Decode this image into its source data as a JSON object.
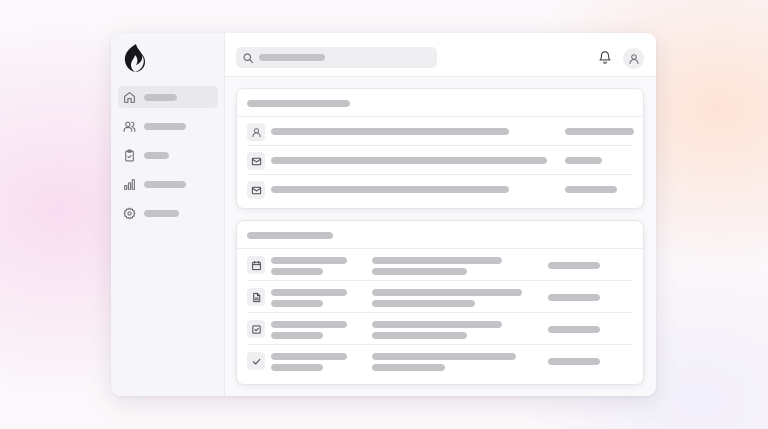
{
  "app": {
    "logo_icon": "flame-logo-icon",
    "colors": {
      "placeholder_bar": "#c3c2c6",
      "icon_stroke": "#6e6d72",
      "sidebar_bg": "#f6f5f8",
      "active_item_bg": "#e9e8ec"
    }
  },
  "sidebar": {
    "items": [
      {
        "icon": "home-icon",
        "active": true
      },
      {
        "icon": "users-icon",
        "active": false
      },
      {
        "icon": "clipboard-check-icon",
        "active": false
      },
      {
        "icon": "bar-chart-icon",
        "active": false
      },
      {
        "icon": "gear-icon",
        "active": false
      }
    ]
  },
  "topbar": {
    "search_icon": "search-icon",
    "notification_icon": "bell-icon",
    "avatar_icon": "user-icon"
  },
  "inbox_card": {
    "rows": [
      {
        "icon": "user-icon"
      },
      {
        "icon": "mail-icon"
      },
      {
        "icon": "mail-icon"
      }
    ]
  },
  "tasks_card": {
    "rows": [
      {
        "icon": "calendar-icon"
      },
      {
        "icon": "document-icon"
      },
      {
        "icon": "checkbox-icon"
      },
      {
        "icon": "check-icon"
      }
    ]
  }
}
